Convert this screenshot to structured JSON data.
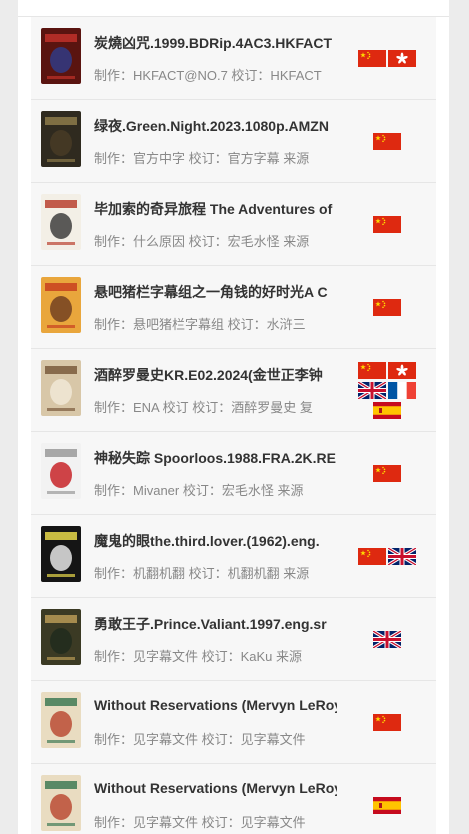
{
  "items": [
    {
      "title": "炭燒凶咒.1999.BDRip.4AC3.HKFACT",
      "meta": "制作：HKFACT@NO.7 校订：HKFACT",
      "flags": [
        "cn",
        "hk"
      ],
      "poster_colors": [
        "#5a1410",
        "#c0302a",
        "#2d3c8c"
      ]
    },
    {
      "title": "绿夜.Green.Night.2023.1080p.AMZN",
      "meta": "制作：官方中字 校订：官方字幕 来源",
      "flags": [
        "cn"
      ],
      "poster_colors": [
        "#2f2a1f",
        "#8c7a4a",
        "#4a3c25"
      ]
    },
    {
      "title": "毕加索的奇异旅程 The Adventures of",
      "meta": "制作：什么原因 校订：宏毛水怪 来源",
      "flags": [
        "cn"
      ],
      "poster_colors": [
        "#f3efe6",
        "#b9412f",
        "#333333"
      ]
    },
    {
      "title": "悬吧猪栏字幕组之一角钱的好时光A C",
      "meta": "制作：悬吧猪栏字幕组 校订：水浒三",
      "flags": [
        "cn"
      ],
      "poster_colors": [
        "#e9a63c",
        "#c8401f",
        "#6b3b1f"
      ]
    },
    {
      "title": "酒醉罗曼史KR.E02.2024(金世正李钟",
      "meta": "制作：ENA 校订 校订：酒醉罗曼史 复",
      "flags": [
        "cn",
        "hk",
        "gb",
        "fr",
        "es"
      ],
      "poster_colors": [
        "#d8c7a8",
        "#7a5a3c",
        "#f2ead8"
      ]
    },
    {
      "title": "神秘失踪 Spoorloos.1988.FRA.2K.RE",
      "meta": "制作：Mivaner 校订：宏毛水怪 来源",
      "flags": [
        "cn"
      ],
      "poster_colors": [
        "#f2f2f2",
        "#9a9a9a",
        "#c4161c"
      ]
    },
    {
      "title": "魔鬼的眼the.third.lover.(1962).eng.",
      "meta": "制作：机翻机翻 校订：机翻机翻 来源",
      "flags": [
        "cn",
        "gb"
      ],
      "poster_colors": [
        "#151515",
        "#e8d84a",
        "#f2f2f2"
      ]
    },
    {
      "title": "勇敢王子.Prince.Valiant.1997.eng.sr",
      "meta": "制作：见字幕文件 校订：KaKu 来源",
      "flags": [
        "gb"
      ],
      "poster_colors": [
        "#3b3a24",
        "#b89a56",
        "#1f2a1d"
      ]
    },
    {
      "title": "Without Reservations (Mervyn LeRoy",
      "meta": "制作：见字幕文件 校订：见字幕文件",
      "flags": [
        "cn"
      ],
      "poster_colors": [
        "#e9dcc1",
        "#3f7a55",
        "#b8432c"
      ]
    },
    {
      "title": "Without Reservations (Mervyn LeRoy",
      "meta": "制作：见字幕文件 校订：见字幕文件",
      "flags": [
        "es"
      ],
      "poster_colors": [
        "#e9dcc1",
        "#3f7a55",
        "#b8432c"
      ]
    }
  ]
}
